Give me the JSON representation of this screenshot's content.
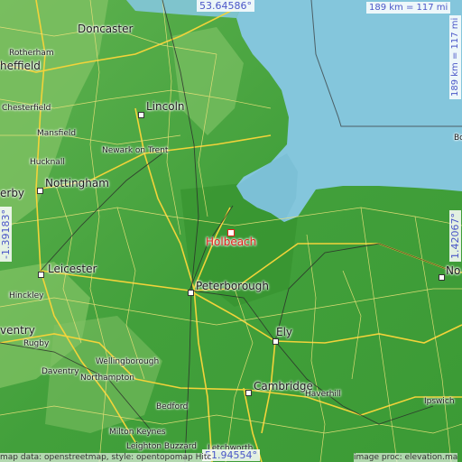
{
  "map": {
    "colors": {
      "sea": "#84c6dc",
      "land_low": "#4aa844",
      "land_high": "#7fc36a",
      "road_major": "#f2d33a",
      "road_minor": "#e8e070",
      "rail": "#2a2a2a",
      "label_focus": "#e0201a",
      "coord_text": "#4b57c8"
    },
    "coords": {
      "lat_top": "53.64586°",
      "lat_bottom": "51.94554°",
      "lon_left": "-1.39183°",
      "lon_right": "1.42067°",
      "scale_top": "189 km = 117 mi",
      "scale_right": "189 km = 117 mi"
    },
    "focus_place": "Holbeach",
    "places": [
      {
        "id": "doncaster",
        "name": "Doncaster"
      },
      {
        "id": "rotherham",
        "name": "Rotherham"
      },
      {
        "id": "sheffield",
        "name": "heffield"
      },
      {
        "id": "chesterfield",
        "name": "Chesterfield"
      },
      {
        "id": "lincoln",
        "name": "Lincoln"
      },
      {
        "id": "mansfield",
        "name": "Mansfield"
      },
      {
        "id": "newark",
        "name": "Newark on Trent"
      },
      {
        "id": "hucknall",
        "name": "Hucknall"
      },
      {
        "id": "derby",
        "name": "erby"
      },
      {
        "id": "nottingham",
        "name": "Nottingham"
      },
      {
        "id": "boston",
        "name": "Boston"
      },
      {
        "id": "leicester",
        "name": "Leicester"
      },
      {
        "id": "hinckley",
        "name": "Hinckley"
      },
      {
        "id": "peterborough",
        "name": "Peterborough"
      },
      {
        "id": "coventry",
        "name": "ventry"
      },
      {
        "id": "rugby",
        "name": "Rugby"
      },
      {
        "id": "ely",
        "name": "Ely"
      },
      {
        "id": "daventry",
        "name": "Daventry"
      },
      {
        "id": "wellingborough",
        "name": "Wellingborough"
      },
      {
        "id": "northampton",
        "name": "Northampton"
      },
      {
        "id": "bedford",
        "name": "Bedford"
      },
      {
        "id": "cambridge",
        "name": "Cambridge"
      },
      {
        "id": "haverhill",
        "name": "Haverhill"
      },
      {
        "id": "ipswich",
        "name": "Ipswich"
      },
      {
        "id": "miltonkeynes",
        "name": "Milton Keynes"
      },
      {
        "id": "leighton",
        "name": "Leighton Buzzard"
      },
      {
        "id": "letchworth",
        "name": "Letchworth"
      },
      {
        "id": "norwich",
        "name": "No"
      }
    ],
    "credit_left": "map data: openstreetmap, style: opentopomap Hitc",
    "credit_right": "image proc: elevation.ma"
  }
}
